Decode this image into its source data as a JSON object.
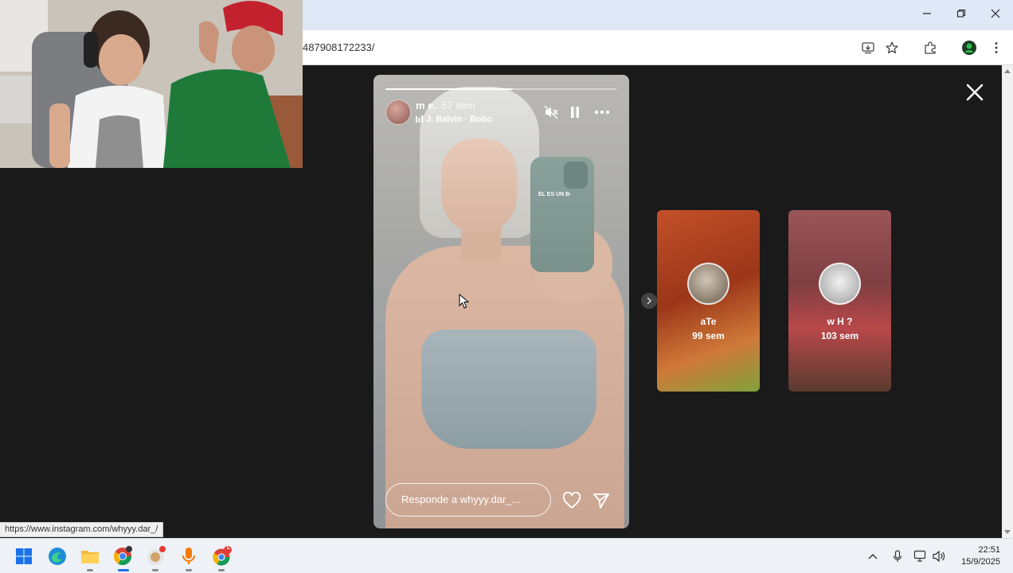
{
  "browser": {
    "url_partial": "487908172233/",
    "status_link": "https://www.instagram.com/whyyy.dar_/"
  },
  "story": {
    "username": "m e.",
    "time_ago": "57 sem",
    "music": "J. Balvin · Bobo",
    "progress_fraction": 0.55,
    "phone_case_text": "EL ES UN B-",
    "reply_placeholder": "Responde a whyyy.dar_..."
  },
  "previews": [
    {
      "name": "aTe",
      "time": "99 sem"
    },
    {
      "name": "w H ?",
      "time": "103 sem"
    }
  ],
  "taskbar": {
    "time": "22:51",
    "date": "15/9/2025",
    "badge": "L"
  },
  "colors": {
    "page_bg": "#1a1a1a",
    "titlebar": "#dfe8f7",
    "taskbar": "#eef1f6",
    "accent_red": "#e53935"
  }
}
